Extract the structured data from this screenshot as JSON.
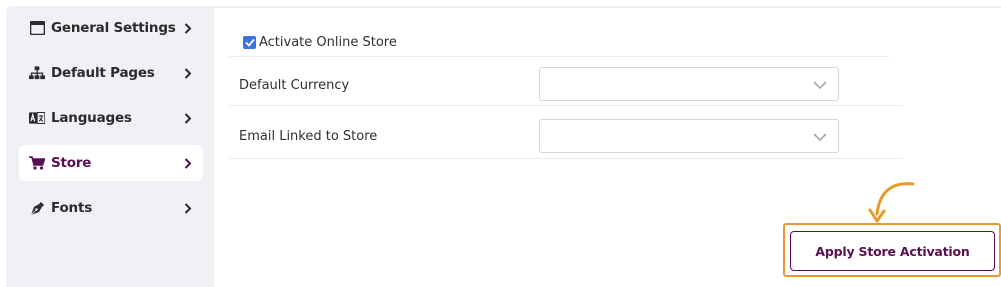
{
  "sidebar": {
    "items": [
      {
        "label": "General Settings",
        "icon": "window-icon"
      },
      {
        "label": "Default Pages",
        "icon": "sitemap-icon"
      },
      {
        "label": "Languages",
        "icon": "language-icon"
      },
      {
        "label": "Store",
        "icon": "cart-icon",
        "active": true
      },
      {
        "label": "Fonts",
        "icon": "pen-nib-icon"
      }
    ]
  },
  "form": {
    "activate_label": "Activate Online Store",
    "activate_checked": true,
    "currency_label": "Default Currency",
    "currency_value": "",
    "email_label": "Email Linked to Store",
    "email_value": ""
  },
  "apply_button": {
    "label": "Apply Store Activation"
  },
  "colors": {
    "accent": "#5a0f52",
    "highlight": "#e89b2a",
    "checkbox": "#3b74e0",
    "sidebar_bg": "#f0f1f6"
  }
}
